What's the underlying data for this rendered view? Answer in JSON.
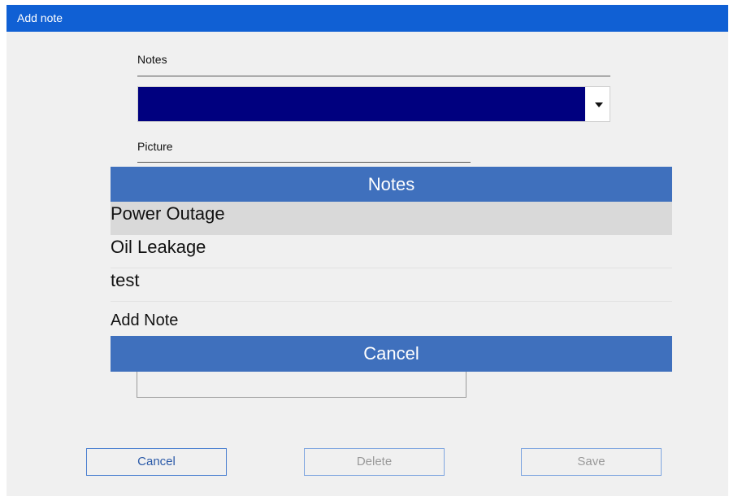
{
  "window": {
    "title": "Add note"
  },
  "form": {
    "notes_label": "Notes",
    "picture_label": "Picture"
  },
  "dropdown_popup": {
    "header": "Notes",
    "items": [
      {
        "label": "Power Outage",
        "selected": true
      },
      {
        "label": "Oil Leakage",
        "selected": false
      },
      {
        "label": "test",
        "selected": false
      }
    ],
    "add_note_label": "Add Note",
    "cancel_label": "Cancel"
  },
  "buttons": {
    "cancel": "Cancel",
    "delete": "Delete",
    "save": "Save"
  },
  "colors": {
    "titlebar": "#1060d4",
    "popup_accent": "#3f70bd",
    "combo_selection": "#00007f",
    "selected_item": "#d9d9d9"
  },
  "icons": {
    "combo_arrow": "chevron-down-icon"
  }
}
